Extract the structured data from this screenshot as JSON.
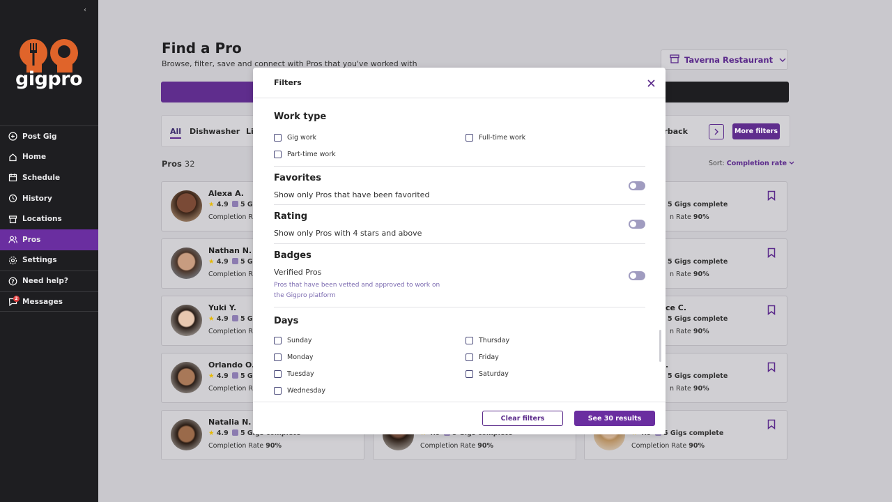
{
  "brand": {
    "name": "gigpro",
    "accent": "#6a2ea0",
    "logo_color": "#e0642a"
  },
  "sidebar": {
    "collapse_icon": "chevron-left-icon",
    "items": [
      {
        "label": "Post Gig",
        "icon": "plus-circle-icon"
      },
      {
        "label": "Home",
        "icon": "home-icon"
      },
      {
        "label": "Schedule",
        "icon": "calendar-icon"
      },
      {
        "label": "History",
        "icon": "history-icon"
      },
      {
        "label": "Locations",
        "icon": "store-icon"
      },
      {
        "label": "Pros",
        "icon": "users-icon",
        "active": true
      },
      {
        "label": "Settings",
        "icon": "gear-icon"
      },
      {
        "label": "Need help?",
        "icon": "help-icon"
      },
      {
        "label": "Messages",
        "icon": "message-icon",
        "badge": "2"
      }
    ]
  },
  "header": {
    "title": "Find a Pro",
    "subtitle": "Browse, filter, save and connect with Pros that you've worked with",
    "restaurant": "Taverna Restaurant"
  },
  "tabs": {
    "all": "All",
    "dishwasher": "Dishwasher",
    "partial": "Li",
    "right_partial": "arback"
  },
  "toolbar": {
    "more_filters": "More filters"
  },
  "list": {
    "label": "Pros",
    "count": "32",
    "sort_label": "Sort:",
    "sort_value": "Completion rate"
  },
  "cards_left": [
    {
      "name": "Alexa A.",
      "rating": "4.9",
      "gigs": "5 G",
      "comp": "Completion R"
    },
    {
      "name": "Nathan N.",
      "rating": "4.9",
      "gigs": "5 G",
      "comp": "Completion R"
    },
    {
      "name": "Yuki Y.",
      "rating": "4.9",
      "gigs": "5 G",
      "comp": "Completion R"
    },
    {
      "name": "Orlando O.",
      "rating": "4.9",
      "gigs": "5 G",
      "comp": "Completion R"
    },
    {
      "name": "Natalia N.",
      "rating": "4.9",
      "gigs": "5 Gigs complete",
      "comp": "Completion Rate",
      "rate": "90%"
    }
  ],
  "cards_right": [
    {
      "name": "",
      "gigs": "5 Gigs complete",
      "rate_label": "n Rate",
      "rate": "90%"
    },
    {
      "name": "",
      "gigs": "5 Gigs complete",
      "rate_label": "n Rate",
      "rate": "90%"
    },
    {
      "name": "ce C.",
      "gigs": "5 Gigs complete",
      "rate_label": "n Rate",
      "rate": "90%"
    },
    {
      "name": ".",
      "gigs": "5 Gigs complete",
      "rate_label": "n Rate",
      "rate": "90%"
    },
    {
      "name": "D.",
      "rating": "4.9",
      "gigs": "5 Gigs complete",
      "comp": "Completion Rate",
      "rate": "90%"
    }
  ],
  "card_middle_bottom": {
    "rating": "4.9",
    "gigs": "5 Gigs complete",
    "comp": "Completion Rate",
    "rate": "90%"
  },
  "modal": {
    "title": "Filters",
    "work_type": {
      "title": "Work type",
      "options": [
        "Gig work",
        "Full-time work",
        "Part-time work"
      ]
    },
    "favorites": {
      "title": "Favorites",
      "desc": "Show only Pros that have been favorited",
      "on": false
    },
    "rating": {
      "title": "Rating",
      "desc": "Show only Pros with 4 stars and above",
      "on": false
    },
    "badges": {
      "title": "Badges",
      "desc": "Verified Pros",
      "note": "Pros that have been vetted and approved to work on the Gigpro platform",
      "on": false
    },
    "days": {
      "title": "Days",
      "options": [
        "Sunday",
        "Monday",
        "Tuesday",
        "Wednesday",
        "Thursday",
        "Friday",
        "Saturday"
      ]
    },
    "clear": "Clear filters",
    "see": "See 30 results"
  }
}
